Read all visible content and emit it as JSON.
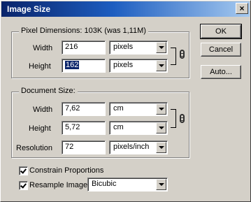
{
  "window": {
    "title": "Image Size",
    "close_glyph": "×"
  },
  "pixel_dimensions": {
    "legend": "Pixel Dimensions:",
    "size_info": "103K (was 1,11M)",
    "width": {
      "label": "Width",
      "value": "216",
      "unit": "pixels"
    },
    "height": {
      "label": "Height",
      "value": "162",
      "unit": "pixels"
    }
  },
  "document_size": {
    "legend": "Document Size:",
    "width": {
      "label": "Width",
      "value": "7,62",
      "unit": "cm"
    },
    "height": {
      "label": "Height",
      "value": "5,72",
      "unit": "cm"
    },
    "resolution": {
      "label": "Resolution",
      "value": "72",
      "unit": "pixels/inch"
    }
  },
  "options": {
    "constrain": {
      "label": "Constrain Proportions",
      "checked": true
    },
    "resample": {
      "label": "Resample Image:",
      "checked": true,
      "method": "Bicubic"
    }
  },
  "buttons": {
    "ok": "OK",
    "cancel": "Cancel",
    "auto": "Auto..."
  },
  "icons": {
    "link": "chain-link-icon",
    "dropdown": "chevron-down-icon",
    "close": "close-icon"
  },
  "colors": {
    "face": "#d4d0c8",
    "title_start": "#0a246a",
    "title_end": "#a6caf0",
    "selection": "#0a246a"
  }
}
